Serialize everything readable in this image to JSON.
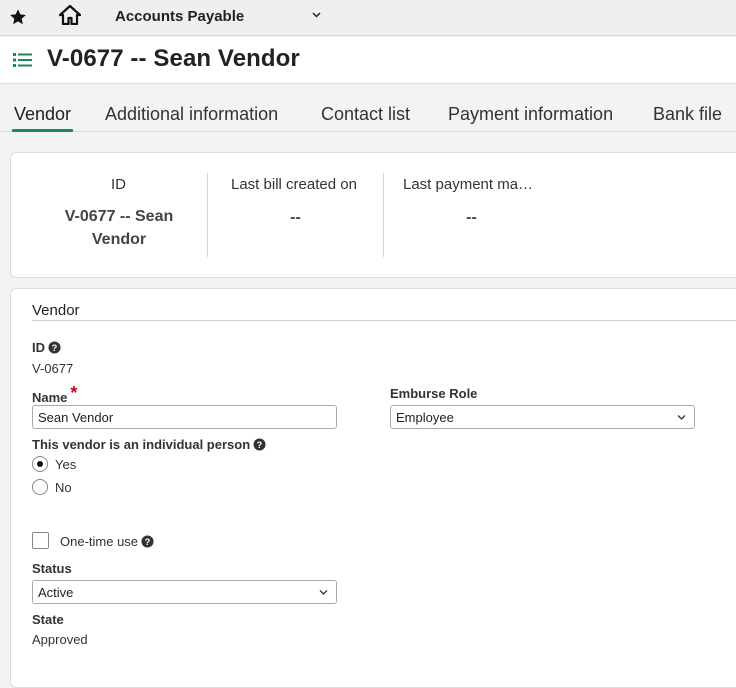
{
  "topbar": {
    "star_icon": "star-icon",
    "home_icon": "home-icon",
    "module": "Accounts Payable",
    "module_chevron": "chevron-down-icon"
  },
  "page": {
    "menu_icon": "list-icon",
    "title": "V-0677 -- Sean Vendor"
  },
  "tabs": [
    {
      "label": "Vendor",
      "active": true
    },
    {
      "label": "Additional information",
      "active": false
    },
    {
      "label": "Contact list",
      "active": false
    },
    {
      "label": "Payment information",
      "active": false
    },
    {
      "label": "Bank file",
      "active": false
    }
  ],
  "summary": {
    "id_label": "ID",
    "id_value_line1": "V-0677 -- Sean",
    "id_value_line2": "Vendor",
    "last_bill_label": "Last bill created on",
    "last_bill_value": "--",
    "last_payment_label": "Last payment ma…",
    "last_payment_value": "--"
  },
  "form": {
    "section_title": "Vendor",
    "id_label": "ID",
    "id_value": "V-0677",
    "name_label": "Name",
    "name_required": "*",
    "name_value": "Sean Vendor",
    "emburse_label": "Emburse  Role",
    "emburse_value": "Employee",
    "individual_label": "This vendor is an individual person",
    "individual_options": [
      {
        "label": "Yes",
        "selected": true
      },
      {
        "label": "No",
        "selected": false
      }
    ],
    "onetime_label": "One-time use",
    "onetime_checked": false,
    "status_label": "Status",
    "status_value": "Active",
    "state_label": "State",
    "state_value": "Approved"
  },
  "colors": {
    "accent": "#1a8a57",
    "required": "#d0021b"
  }
}
